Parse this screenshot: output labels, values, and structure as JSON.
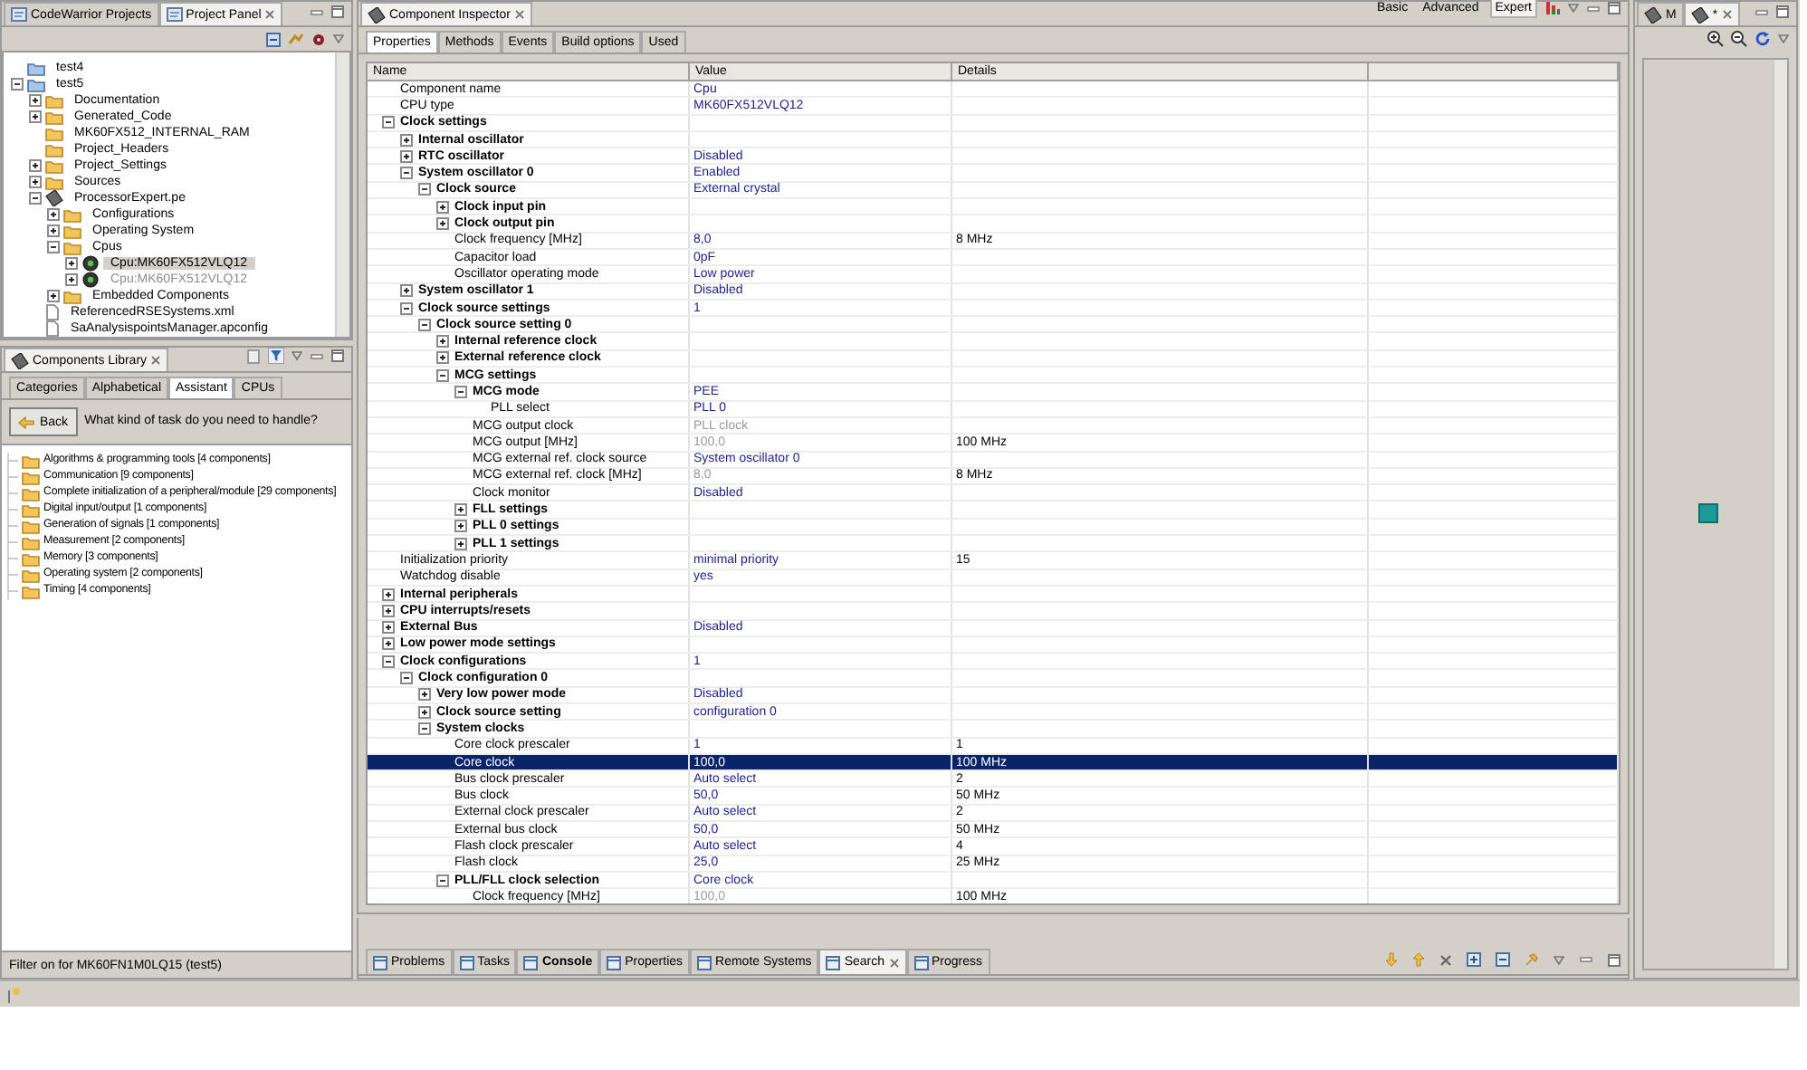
{
  "project_panel": {
    "tabs": [
      {
        "label": "CodeWarrior Projects",
        "selected": false
      },
      {
        "label": "Project Panel",
        "selected": true
      }
    ],
    "tree": [
      {
        "label": "test4",
        "kind": "project",
        "selected": false,
        "disabled": false
      },
      {
        "label": "test5",
        "kind": "project",
        "expanded": true,
        "selected": false,
        "disabled": false,
        "children": [
          {
            "label": "Documentation",
            "kind": "folder",
            "expanded": false,
            "selected": false,
            "disabled": false
          },
          {
            "label": "Generated_Code",
            "kind": "folder",
            "expanded": false,
            "selected": false,
            "disabled": false
          },
          {
            "label": "MK60FX512_INTERNAL_RAM",
            "kind": "folder",
            "selected": false,
            "disabled": false
          },
          {
            "label": "Project_Headers",
            "kind": "folder",
            "selected": false,
            "disabled": false
          },
          {
            "label": "Project_Settings",
            "kind": "folder",
            "expanded": false,
            "selected": false,
            "disabled": false
          },
          {
            "label": "Sources",
            "kind": "folder",
            "expanded": false,
            "selected": false,
            "disabled": false
          },
          {
            "label": "ProcessorExpert.pe",
            "kind": "pe",
            "expanded": true,
            "selected": false,
            "disabled": false,
            "children": [
              {
                "label": "Configurations",
                "kind": "folder",
                "expanded": false,
                "selected": false,
                "disabled": false
              },
              {
                "label": "Operating System",
                "kind": "folder",
                "expanded": false,
                "selected": false,
                "disabled": false
              },
              {
                "label": "Cpus",
                "kind": "folder",
                "expanded": true,
                "selected": false,
                "disabled": false,
                "children": [
                  {
                    "label": "Cpu:MK60FX512VLQ12",
                    "kind": "cpu",
                    "expanded": false,
                    "selected": true,
                    "disabled": false
                  },
                  {
                    "label": "Cpu:MK60FX512VLQ12",
                    "kind": "cpu",
                    "expanded": false,
                    "selected": false,
                    "disabled": true
                  }
                ]
              },
              {
                "label": "Embedded Components",
                "kind": "folder",
                "expanded": false,
                "selected": false,
                "disabled": false
              }
            ]
          },
          {
            "label": "ReferencedRSESystems.xml",
            "kind": "file",
            "selected": false,
            "disabled": false
          },
          {
            "label": "SaAnalysispointsManager.apconfig",
            "kind": "file",
            "selected": false,
            "disabled": false
          }
        ]
      }
    ]
  },
  "components_library": {
    "title": "Components Library",
    "tabs": [
      {
        "label": "Categories",
        "selected": false
      },
      {
        "label": "Alphabetical",
        "selected": false
      },
      {
        "label": "Assistant",
        "selected": true
      },
      {
        "label": "CPUs",
        "selected": false
      }
    ],
    "back_button": "Back",
    "question": "What kind of task do you need to handle?",
    "categories": [
      "Algorithms & programming tools [4 components]",
      "Communication [9 components]",
      "Complete initialization of a peripheral/module [29 components]",
      "Digital input/output [1 components]",
      "Generation of signals [1 components]",
      "Measurement [2 components]",
      "Memory [3 components]",
      "Operating system [2 components]",
      "Timing [4 components]"
    ],
    "status": "Filter on for MK60FN1M0LQ15 (test5)"
  },
  "inspector": {
    "title": "Component Inspector",
    "modes": [
      {
        "label": "Basic",
        "selected": false
      },
      {
        "label": "Advanced",
        "selected": false
      },
      {
        "label": "Expert",
        "selected": true
      }
    ],
    "tabs": [
      {
        "label": "Properties",
        "selected": true
      },
      {
        "label": "Methods",
        "selected": false
      },
      {
        "label": "Events",
        "selected": false
      },
      {
        "label": "Build options",
        "selected": false
      },
      {
        "label": "Used",
        "selected": false
      }
    ],
    "columns": [
      "Name",
      "Value",
      "Details"
    ],
    "properties": [
      {
        "name": "Component name",
        "value": "Cpu",
        "readonly": false,
        "selected": false
      },
      {
        "name": "CPU type",
        "value": "MK60FX512VLQ12",
        "readonly": false,
        "selected": false
      },
      {
        "name": "Clock settings",
        "expanded": true,
        "selected": false,
        "children": [
          {
            "name": "Internal oscillator",
            "expanded": false,
            "selected": false
          },
          {
            "name": "RTC oscillator",
            "expanded": false,
            "value": "Disabled",
            "readonly": false,
            "selected": false
          },
          {
            "name": "System oscillator 0",
            "expanded": true,
            "value": "Enabled",
            "readonly": false,
            "selected": false,
            "children": [
              {
                "name": "Clock source",
                "expanded": true,
                "value": "External crystal",
                "readonly": false,
                "selected": false,
                "children": [
                  {
                    "name": "Clock input pin",
                    "expanded": false,
                    "selected": false
                  },
                  {
                    "name": "Clock output pin",
                    "expanded": false,
                    "selected": false
                  },
                  {
                    "name": "Clock frequency [MHz]",
                    "value": "8,0",
                    "details": "8 MHz",
                    "readonly": false,
                    "selected": false
                  },
                  {
                    "name": "Capacitor load",
                    "value": "0pF",
                    "readonly": false,
                    "selected": false
                  },
                  {
                    "name": "Oscillator operating mode",
                    "value": "Low power",
                    "readonly": false,
                    "selected": false
                  }
                ]
              }
            ]
          },
          {
            "name": "System oscillator 1",
            "expanded": false,
            "value": "Disabled",
            "readonly": false,
            "selected": false
          },
          {
            "name": "Clock source settings",
            "expanded": true,
            "value": "1",
            "readonly": false,
            "selected": false,
            "children": [
              {
                "name": "Clock source setting 0",
                "expanded": true,
                "selected": false,
                "children": [
                  {
                    "name": "Internal reference clock",
                    "expanded": false,
                    "selected": false
                  },
                  {
                    "name": "External reference clock",
                    "expanded": false,
                    "selected": false
                  },
                  {
                    "name": "MCG settings",
                    "expanded": true,
                    "selected": false,
                    "children": [
                      {
                        "name": "MCG mode",
                        "expanded": true,
                        "value": "PEE",
                        "readonly": false,
                        "selected": false,
                        "children": [
                          {
                            "name": "PLL select",
                            "value": "PLL 0",
                            "readonly": false,
                            "selected": false
                          }
                        ]
                      },
                      {
                        "name": "MCG output clock",
                        "value": "PLL clock",
                        "readonly": true,
                        "selected": false
                      },
                      {
                        "name": "MCG output [MHz]",
                        "value": "100,0",
                        "details": "100 MHz",
                        "readonly": true,
                        "selected": false
                      },
                      {
                        "name": "MCG external ref. clock source",
                        "value": "System oscillator 0",
                        "readonly": false,
                        "selected": false
                      },
                      {
                        "name": "MCG external ref. clock [MHz]",
                        "value": "8,0",
                        "details": "8 MHz",
                        "readonly": true,
                        "selected": false
                      },
                      {
                        "name": "Clock monitor",
                        "value": "Disabled",
                        "readonly": false,
                        "selected": false
                      },
                      {
                        "name": "FLL settings",
                        "expanded": false,
                        "selected": false
                      },
                      {
                        "name": "PLL 0 settings",
                        "expanded": false,
                        "selected": false
                      },
                      {
                        "name": "PLL 1 settings",
                        "expanded": false,
                        "selected": false
                      }
                    ]
                  }
                ]
              }
            ]
          }
        ]
      },
      {
        "name": "Initialization priority",
        "value": "minimal priority",
        "details": "15",
        "readonly": false,
        "selected": false
      },
      {
        "name": "Watchdog disable",
        "value": "yes",
        "readonly": false,
        "selected": false
      },
      {
        "name": "Internal peripherals",
        "expanded": false,
        "selected": false
      },
      {
        "name": "CPU interrupts/resets",
        "expanded": false,
        "selected": false
      },
      {
        "name": "External Bus",
        "expanded": false,
        "value": "Disabled",
        "readonly": false,
        "selected": false
      },
      {
        "name": "Low power mode settings",
        "expanded": false,
        "selected": false
      },
      {
        "name": "Clock configurations",
        "expanded": true,
        "value": "1",
        "readonly": false,
        "selected": false,
        "children": [
          {
            "name": "Clock configuration 0",
            "expanded": true,
            "selected": false,
            "children": [
              {
                "name": "Very low power mode",
                "expanded": false,
                "value": "Disabled",
                "readonly": false,
                "selected": false
              },
              {
                "name": "Clock source setting",
                "expanded": false,
                "value": "configuration 0",
                "readonly": false,
                "selected": false
              },
              {
                "name": "System clocks",
                "expanded": true,
                "selected": false,
                "children": [
                  {
                    "name": "Core clock prescaler",
                    "value": "1",
                    "details": "1",
                    "readonly": false,
                    "selected": false
                  },
                  {
                    "name": "Core clock",
                    "value": "100,0",
                    "details": "100 MHz",
                    "readonly": false,
                    "selected": true
                  },
                  {
                    "name": "Bus clock prescaler",
                    "value": "Auto select",
                    "details": "2",
                    "readonly": false,
                    "selected": false
                  },
                  {
                    "name": "Bus clock",
                    "value": "50,0",
                    "details": "50 MHz",
                    "readonly": false,
                    "selected": false
                  },
                  {
                    "name": "External clock prescaler",
                    "value": "Auto select",
                    "details": "2",
                    "readonly": false,
                    "selected": false
                  },
                  {
                    "name": "External bus clock",
                    "value": "50,0",
                    "details": "50 MHz",
                    "readonly": false,
                    "selected": false
                  },
                  {
                    "name": "Flash clock prescaler",
                    "value": "Auto select",
                    "details": "4",
                    "readonly": false,
                    "selected": false
                  },
                  {
                    "name": "Flash clock",
                    "value": "25,0",
                    "details": "25 MHz",
                    "readonly": false,
                    "selected": false
                  },
                  {
                    "name": "PLL/FLL clock selection",
                    "expanded": true,
                    "value": "Core clock",
                    "readonly": false,
                    "selected": false,
                    "children": [
                      {
                        "name": "Clock frequency [MHz]",
                        "value": "100,0",
                        "details": "100 MHz",
                        "readonly": true,
                        "selected": false
                      }
                    ]
                  }
                ]
              }
            ]
          }
        ]
      }
    ]
  },
  "bottom_tabs": [
    {
      "label": "Problems",
      "selected": false,
      "emphasized": false
    },
    {
      "label": "Tasks",
      "selected": false,
      "emphasized": false
    },
    {
      "label": "Console",
      "selected": false,
      "emphasized": true
    },
    {
      "label": "Properties",
      "selected": false,
      "emphasized": false
    },
    {
      "label": "Remote Systems",
      "selected": false,
      "emphasized": false
    },
    {
      "label": "Search",
      "selected": true,
      "emphasized": false
    },
    {
      "label": "Progress",
      "selected": false,
      "emphasized": false
    }
  ],
  "right_panel": {
    "tabs": [
      {
        "label": "M",
        "selected": false
      },
      {
        "label": "*",
        "selected": true
      }
    ]
  }
}
